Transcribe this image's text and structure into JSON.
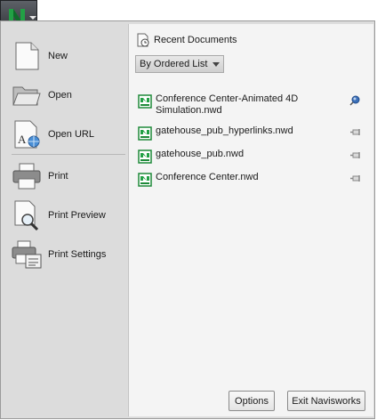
{
  "left_commands": [
    {
      "label": "New",
      "icon": "new-document-icon"
    },
    {
      "label": "Open",
      "icon": "open-folder-icon"
    },
    {
      "label": "Open URL",
      "icon": "open-url-icon"
    },
    {
      "label": "Print",
      "icon": "printer-icon"
    },
    {
      "label": "Print Preview",
      "icon": "print-preview-icon"
    },
    {
      "label": "Print Settings",
      "icon": "print-settings-icon"
    }
  ],
  "recent": {
    "title": "Recent Documents",
    "sort_value": "By Ordered List",
    "documents": [
      {
        "name": "Conference Center-Animated 4D Simulation.nwd",
        "pinned": true
      },
      {
        "name": "gatehouse_pub_hyperlinks.nwd",
        "pinned": false
      },
      {
        "name": "gatehouse_pub.nwd",
        "pinned": false
      },
      {
        "name": "Conference Center.nwd",
        "pinned": false
      }
    ]
  },
  "footer": {
    "options_label": "Options",
    "exit_label": "Exit Navisworks"
  },
  "colors": {
    "brand_green": "#1f8a3a",
    "pin_blue": "#3b6fb8",
    "menu_bg": "#dcdcdc",
    "panel_bg": "#f4f4f4"
  }
}
